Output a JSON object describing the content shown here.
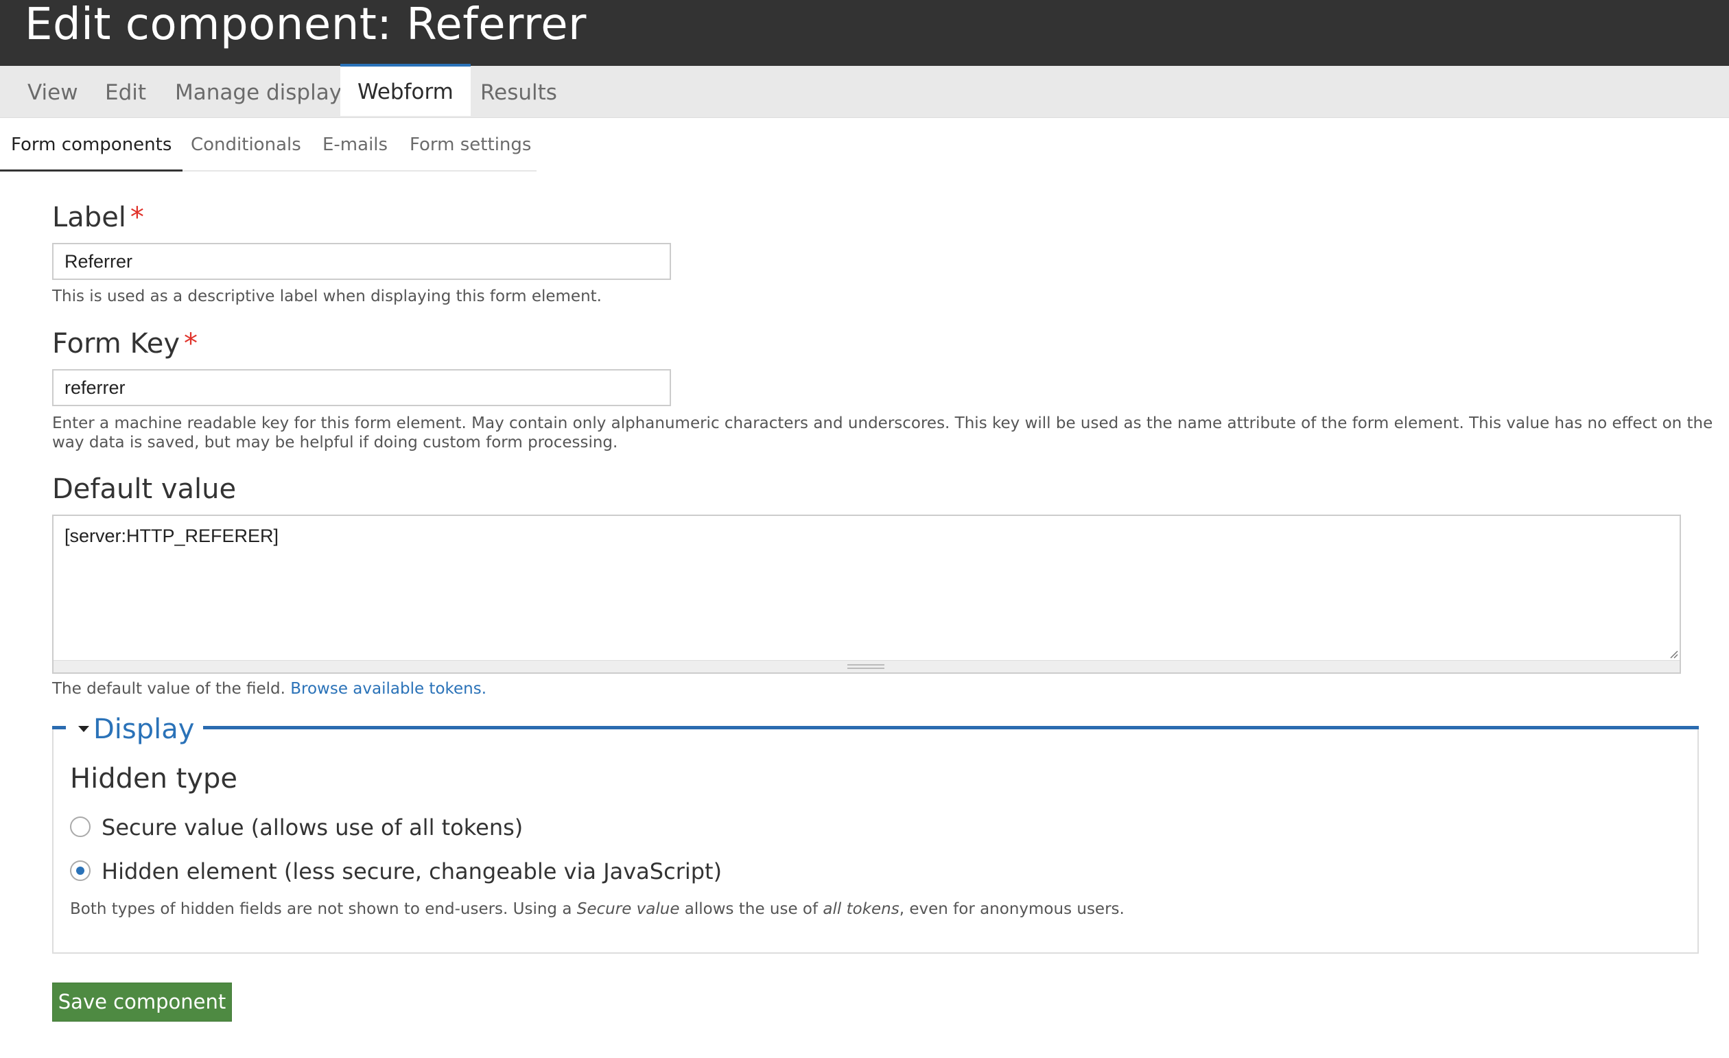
{
  "page": {
    "title": "Edit component: Referrer"
  },
  "primary_tabs": [
    {
      "label": "View",
      "active": false
    },
    {
      "label": "Edit",
      "active": false
    },
    {
      "label": "Manage display",
      "active": false
    },
    {
      "label": "Webform",
      "active": true
    },
    {
      "label": "Results",
      "active": false
    }
  ],
  "secondary_tabs": [
    {
      "label": "Form components",
      "active": true
    },
    {
      "label": "Conditionals",
      "active": false
    },
    {
      "label": "E-mails",
      "active": false
    },
    {
      "label": "Form settings",
      "active": false
    }
  ],
  "form": {
    "label_field": {
      "label": "Label",
      "required_marker": "*",
      "value": "Referrer",
      "description": "This is used as a descriptive label when displaying this form element."
    },
    "form_key_field": {
      "label": "Form Key",
      "required_marker": "*",
      "value": "referrer",
      "description_line1": "Enter a machine readable key for this form element. May contain only alphanumeric characters and underscores. This key will be used as the name attribute of the form element. This value has no effect on the",
      "description_line2": "way data is saved, but may be helpful if doing custom form processing."
    },
    "default_value_field": {
      "label": "Default value",
      "value": "[server:HTTP_REFERER]",
      "description_prefix": "The default value of the field.",
      "link_text": "Browse available tokens."
    }
  },
  "display_fieldset": {
    "legend": "Display",
    "expanded": true,
    "hidden_type": {
      "label": "Hidden type",
      "options": [
        {
          "label": "Secure value (allows use of all tokens)",
          "checked": false
        },
        {
          "label": "Hidden element (less secure, changeable via JavaScript)",
          "checked": true
        }
      ],
      "description_part1": "Both types of hidden fields are not shown to end-users. Using a",
      "description_em1": "Secure value",
      "description_part2": "allows the use of",
      "description_em2": "all tokens",
      "description_part3": ", even for anonymous users."
    }
  },
  "actions": {
    "save_label": "Save component"
  },
  "colors": {
    "header_bg": "#333333",
    "tab_bar_bg": "#e9e9e9",
    "active_tab_accent": "#2a72b8",
    "required": "#e0322a",
    "link": "#2a72b8",
    "save_button": "#4e8a42"
  }
}
